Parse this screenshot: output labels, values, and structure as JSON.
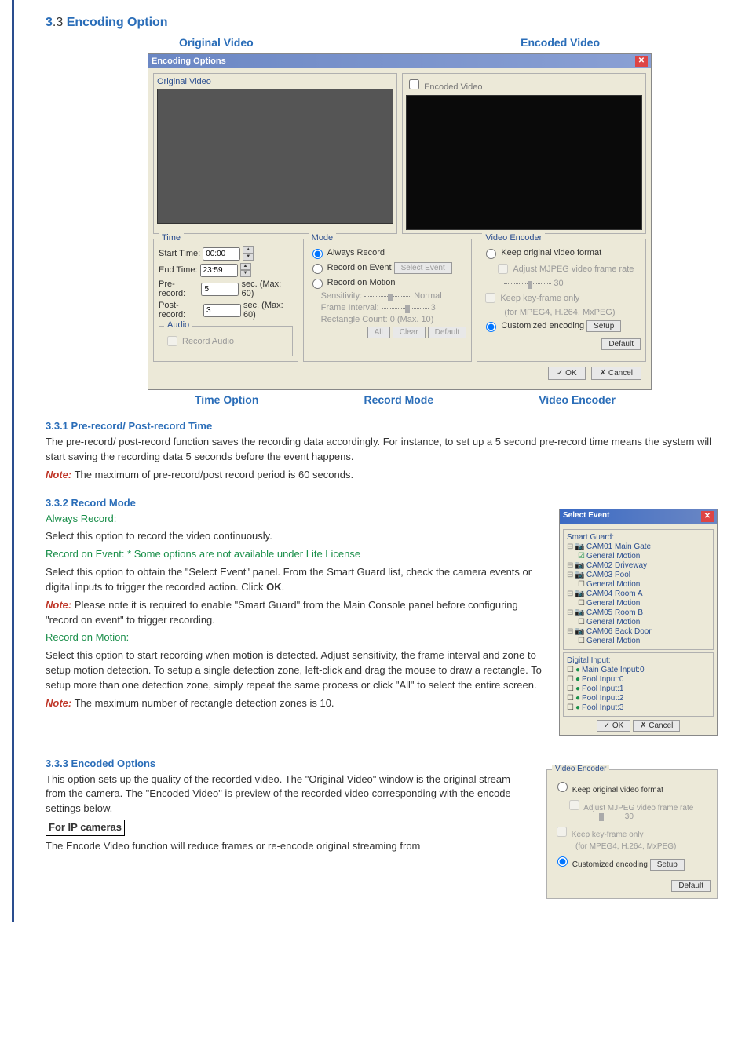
{
  "section": {
    "num": "3",
    "dot": ".3 ",
    "title": "Encoding Option"
  },
  "callouts": {
    "orig": "Original Video",
    "enc": "Encoded Video",
    "time": "Time Option",
    "mode": "Record Mode",
    "venc": "Video Encoder"
  },
  "dialog": {
    "title": "Encoding Options",
    "origLabel": "Original Video",
    "encCheck": "Encoded Video",
    "timeGrp": "Time",
    "startLbl": "Start Time:",
    "startVal": "00:00",
    "endLbl": "End Time:",
    "endVal": "23:59",
    "preLbl": "Pre-record:",
    "preVal": "5",
    "preUnit": "sec. (Max: 60)",
    "postLbl": "Post-record:",
    "postVal": "3",
    "postUnit": "sec. (Max: 60)",
    "audioGrp": "Audio",
    "audioChk": "Record Audio",
    "modeGrp": "Mode",
    "m1": "Always Record",
    "m2": "Record on Event",
    "m2btn": "Select Event",
    "m3": "Record on Motion",
    "sens": "Sensitivity:",
    "sensVal": "Normal",
    "fint": "Frame Interval:",
    "fintVal": "3",
    "rcount": "Rectangle Count: 0 (Max. 10)",
    "bAll": "All",
    "bClear": "Clear",
    "bDef": "Default",
    "veGrp": "Video Encoder",
    "ve1": "Keep original video format",
    "ve1a": "Adjust MJPEG video frame rate",
    "ve1aVal": "30",
    "ve2": "Keep key-frame only",
    "ve2sub": "(for MPEG4, H.264, MxPEG)",
    "ve3": "Customized encoding",
    "veSetup": "Setup",
    "veDef": "Default",
    "ok": "OK",
    "cancel": "Cancel"
  },
  "s331": {
    "title": "3.3.1 Pre-record/ Post-record Time",
    "p1": "The pre-record/ post-record function saves the recording data accordingly. For instance, to set up a 5 second pre-record time means the system will start saving the recording data 5 seconds before the event happens.",
    "note": "Note:",
    "noteTxt": " The maximum of pre-record/post record period is 60 seconds."
  },
  "s332": {
    "title": "3.3.2 Record Mode",
    "always": "Always Record:",
    "alwaysTxt": "Select this option to record the video continuously.",
    "roe": "Record on Event:",
    "roeStar": "   * Some options are not available under Lite License",
    "roeTxt": "Select this option to obtain the \"Select Event\" panel. From the Smart Guard list, check the camera events or digital inputs to trigger the recorded action. Click ",
    "roeOK": "OK",
    "roeTxt2": ".",
    "roeNote": "Note:",
    "roeNoteTxt": " Please note it is required to enable \"Smart Guard\" from the Main Console panel before configuring \"record on event\" to trigger recording.",
    "rom": "Record on Motion:",
    "romTxt": "Select this option to start recording when motion is detected.    Adjust sensitivity, the frame interval and zone to setup motion detection.    To setup a single detection zone, left-click and drag the mouse to draw a rectangle.    To setup more than one detection zone, simply repeat the same process or click \"All\" to select the entire screen.",
    "romNote": "Note:",
    "romNoteTxt": " The maximum number of rectangle detection zones is 10."
  },
  "selEvt": {
    "title": "Select Event",
    "sg": "Smart Guard:",
    "cams": [
      {
        "name": "CAM01 Main Gate",
        "gm": true
      },
      {
        "name": "CAM02 Driveway",
        "gm": false,
        "nogm": true
      },
      {
        "name": "CAM03 Pool",
        "gm": false
      },
      {
        "name": "CAM04 Room A",
        "gm": false
      },
      {
        "name": "CAM05 Room B",
        "gm": false
      },
      {
        "name": "CAM06 Back Door",
        "gm": false
      }
    ],
    "di": "Digital Input:",
    "dis": [
      "Main Gate Input:0",
      "Pool Input:0",
      "Pool Input:1",
      "Pool Input:2",
      "Pool Input:3"
    ],
    "ok": "OK",
    "cancel": "Cancel"
  },
  "s333": {
    "title": "3.3.3 Encoded Options",
    "p1": "This option sets up the quality of the recorded video. The \"Original Video\" window is the original stream from the camera. The \"Encoded Video\" is preview of the recorded video corresponding with the encode settings below.",
    "ip": "For IP cameras",
    "p2": "The Encode Video function will reduce frames or re-encode original streaming from"
  },
  "encPanel": {
    "title": "Video Encoder",
    "o1": "Keep original video format",
    "o1a": "Adjust MJPEG video frame rate",
    "o1aVal": "30",
    "o2": "Keep key-frame only",
    "o2sub": "(for MPEG4, H.264, MxPEG)",
    "o3": "Customized encoding",
    "setup": "Setup",
    "def": "Default"
  }
}
